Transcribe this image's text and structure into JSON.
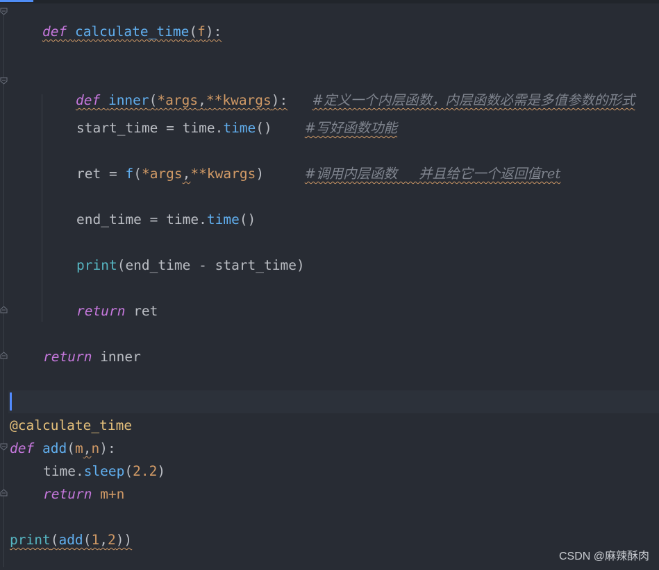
{
  "code": {
    "l1": {
      "kw": "def",
      "name": "calculate_time",
      "open": "(",
      "param": "f",
      "close": "):"
    },
    "l2": {
      "kw": "def",
      "name": "inner",
      "open": "(",
      "args": "*args",
      "comma": ",",
      "kwargs": "**kwargs",
      "close": "):",
      "comment": "#定义一个内层函数，内层函数必需是多值参数的形式"
    },
    "l3": {
      "var": "start_time = time.",
      "call": "time",
      "paren": "()",
      "comment": "#写好函数功能"
    },
    "l4": {
      "lhs": "ret = ",
      "fcall": "f",
      "open": "(",
      "args": "*args",
      "comma": ",",
      "kwargs": "**kwargs",
      "close": ")",
      "comment": "#调用内层函数     并且给它一个返回值ret"
    },
    "l5": {
      "var": "end_time = time.",
      "call": "time",
      "paren": "()"
    },
    "l6": {
      "builtin": "print",
      "rest": "(end_time - start_time)"
    },
    "l7": {
      "kw": "return",
      "rest": " ret"
    },
    "l8": {
      "kw": "return",
      "rest": " inner"
    },
    "l9": {
      "decorator": "@calculate_time"
    },
    "l10": {
      "kw": "def",
      "name": "add",
      "open": "(",
      "m": "m",
      "comma": ",",
      "n": "n",
      "close": "):"
    },
    "l11": {
      "obj": "time.",
      "call": "sleep",
      "open": "(",
      "num": "2.2",
      "close": ")"
    },
    "l12": {
      "kw": "return",
      "rest": " m+n"
    },
    "l13": {
      "builtin": "print",
      "open": "(",
      "fn": "add",
      "open2": "(",
      "a": "1",
      "comma": ",",
      "b": "2",
      "close": "))"
    }
  },
  "watermark": "CSDN @麻辣酥肉",
  "colors": {
    "background": "#282c34",
    "keyword": "#c678dd",
    "function": "#61afef",
    "number": "#d19a66",
    "builtin": "#56b6c2",
    "decorator": "#e5c07b",
    "comment": "#7f848e"
  }
}
